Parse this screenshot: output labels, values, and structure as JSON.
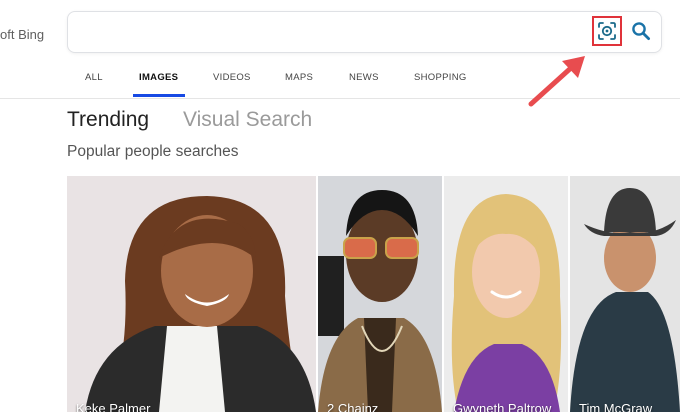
{
  "header": {
    "brand": "oft Bing"
  },
  "search": {
    "placeholder": ""
  },
  "tabs": [
    {
      "label": "ALL"
    },
    {
      "label": "IMAGES"
    },
    {
      "label": "VIDEOS"
    },
    {
      "label": "MAPS"
    },
    {
      "label": "NEWS"
    },
    {
      "label": "SHOPPING"
    }
  ],
  "active_tab": "IMAGES",
  "sections": {
    "trending": "Trending",
    "visual_search": "Visual Search"
  },
  "subtitle": "Popular people searches",
  "cards": [
    {
      "name": "Keke Palmer"
    },
    {
      "name": "2 Chainz"
    },
    {
      "name": "Gwyneth Paltrow"
    },
    {
      "name": "Tim McGraw"
    }
  ],
  "colors": {
    "accent": "#174ae4",
    "highlight_border": "#e0333a",
    "arrow": "#e84c4f",
    "icon": "#1a73a8"
  }
}
